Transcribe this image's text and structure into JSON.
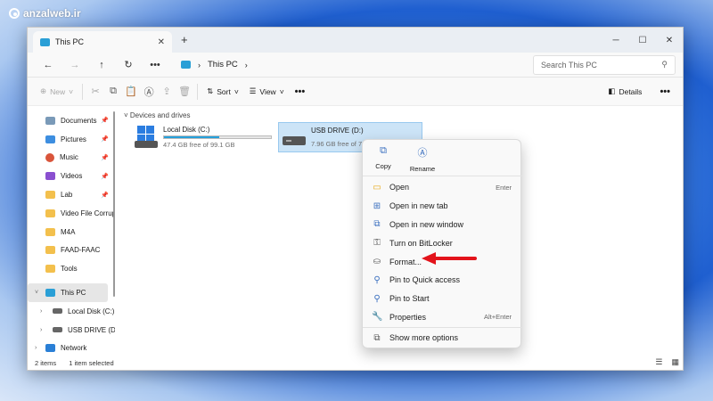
{
  "watermark": "anzalweb.ir",
  "window": {
    "tab_title": "This PC",
    "new_tab": "+"
  },
  "addressbar": {
    "path": "This PC",
    "search_placeholder": "Search This PC"
  },
  "toolbar": {
    "new": "New",
    "sort": "Sort",
    "view": "View",
    "details": "Details"
  },
  "nav": {
    "quick": [
      {
        "label": "Documents",
        "icon": "documents-icon",
        "pinned": true
      },
      {
        "label": "Pictures",
        "icon": "pictures-icon",
        "pinned": true
      },
      {
        "label": "Music",
        "icon": "music-icon",
        "pinned": true
      },
      {
        "label": "Videos",
        "icon": "videos-icon",
        "pinned": true
      },
      {
        "label": "Lab",
        "icon": "folder-icon",
        "pinned": true
      },
      {
        "label": "Video File Corrup",
        "icon": "folder-icon",
        "pinned": false
      },
      {
        "label": "M4A",
        "icon": "folder-icon",
        "pinned": false
      },
      {
        "label": "FAAD-FAAC",
        "icon": "folder-icon",
        "pinned": false
      },
      {
        "label": "Tools",
        "icon": "folder-icon",
        "pinned": false
      }
    ],
    "this_pc": "This PC",
    "local_disk": "Local Disk (C:)",
    "usb_drive": "USB DRIVE (D:)",
    "network": "Network"
  },
  "content": {
    "group": "Devices and drives",
    "drives": [
      {
        "name": "Local Disk (C:)",
        "free": "47.4 GB free of 99.1 GB",
        "used_fraction": 0.52
      },
      {
        "name": "USB DRIVE (D:)",
        "free": "7.96 GB free of 7",
        "used_fraction": 0.05
      }
    ]
  },
  "status": {
    "items": "2 items",
    "selected": "1 item selected"
  },
  "menu": {
    "copy": "Copy",
    "rename": "Rename",
    "items": [
      {
        "label": "Open",
        "shortcut": "Enter"
      },
      {
        "label": "Open in new tab",
        "shortcut": ""
      },
      {
        "label": "Open in new window",
        "shortcut": ""
      },
      {
        "label": "Turn on BitLocker",
        "shortcut": ""
      },
      {
        "label": "Format...",
        "shortcut": ""
      },
      {
        "label": "Pin to Quick access",
        "shortcut": ""
      },
      {
        "label": "Pin to Start",
        "shortcut": ""
      },
      {
        "label": "Properties",
        "shortcut": "Alt+Enter"
      }
    ],
    "more": "Show more options"
  },
  "colors": {
    "accent": "#26a0da",
    "selection": "#cce4f7",
    "arrow": "#e3131b"
  }
}
